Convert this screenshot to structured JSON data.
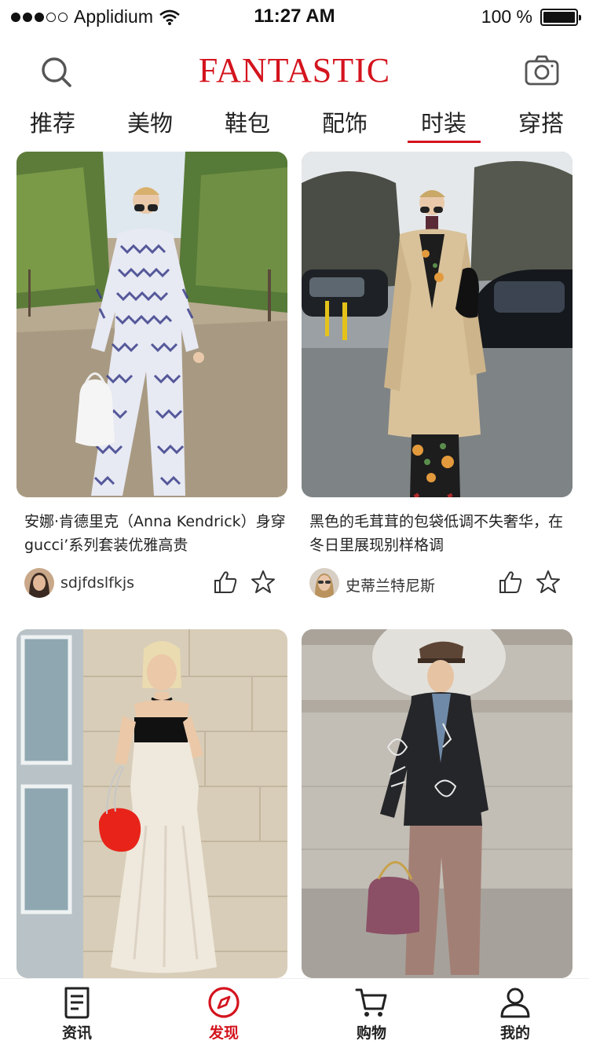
{
  "status_bar": {
    "carrier": "Applidium",
    "time": "11:27 AM",
    "battery": "100 %",
    "signal_icon": "signal-dots-icon",
    "wifi_icon": "wifi-icon"
  },
  "header": {
    "brand": "FANTASTIC",
    "brand_color": "#d4141e",
    "search_icon": "search-icon",
    "camera_icon": "camera-icon"
  },
  "tabs": [
    {
      "label": "推荐",
      "active": false
    },
    {
      "label": "美物",
      "active": false
    },
    {
      "label": "鞋包",
      "active": false
    },
    {
      "label": "配饰",
      "active": false
    },
    {
      "label": "时装",
      "active": true
    },
    {
      "label": "穿搭",
      "active": false
    }
  ],
  "cards": [
    {
      "title": "安娜·肯德里克（Anna Kendrick）身穿gucci’系列套装优雅高贵",
      "author": "sdjfdslfkjs",
      "like_icon": "thumbs-up-icon",
      "fav_icon": "star-icon"
    },
    {
      "title": "黑色的毛茸茸的包袋低调不失奢华，在冬日里展现别样格调",
      "author": "史蒂兰特尼斯",
      "like_icon": "thumbs-up-icon",
      "fav_icon": "star-icon"
    },
    {
      "title": "",
      "author": ""
    },
    {
      "title": "",
      "author": ""
    }
  ],
  "bottom_nav": [
    {
      "label": "资讯",
      "icon": "news-icon",
      "active": false
    },
    {
      "label": "发现",
      "icon": "compass-icon",
      "active": true
    },
    {
      "label": "购物",
      "icon": "cart-icon",
      "active": false
    },
    {
      "label": "我的",
      "icon": "user-icon",
      "active": false
    }
  ]
}
